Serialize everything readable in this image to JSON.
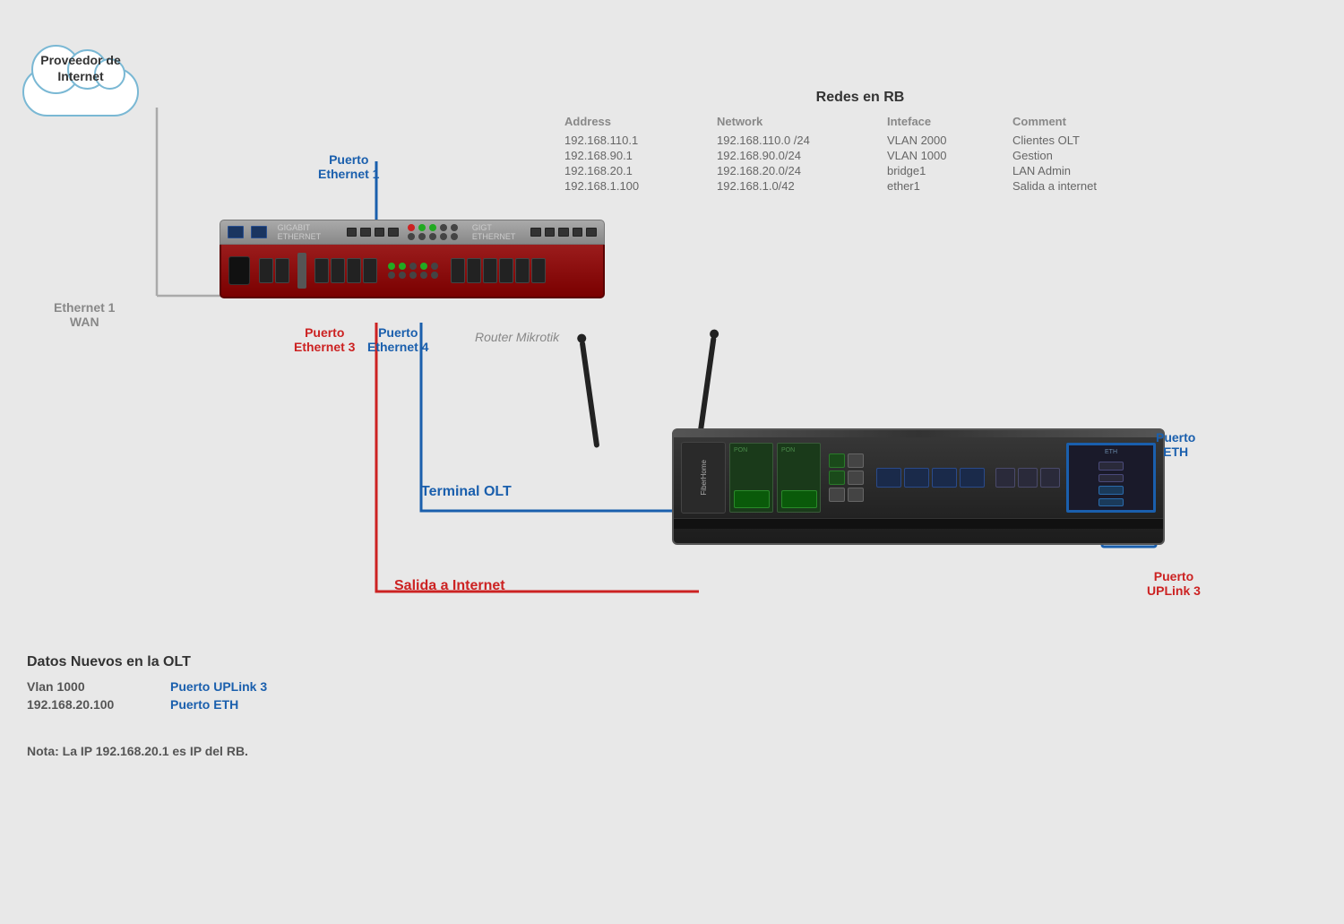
{
  "cloud": {
    "label_line1": "Proveedor de",
    "label_line2": "Internet"
  },
  "ethernet_wan": {
    "label_line1": "Ethernet 1",
    "label_line2": "WAN"
  },
  "router": {
    "label": "Router Mikrotik",
    "puerto_eth1_line1": "Puerto",
    "puerto_eth1_line2": "Ethernet 1",
    "puerto_eth3_line1": "Puerto",
    "puerto_eth3_line2": "Ethernet 3",
    "puerto_eth4_line1": "Puerto",
    "puerto_eth4_line2": "Ethernet 4"
  },
  "olt": {
    "title": "Terminal OLT",
    "puerto_eth_line1": "Puerto",
    "puerto_eth_line2": "ETH",
    "puerto_uplink_line1": "Puerto",
    "puerto_uplink_line2": "UPLink 3",
    "salida_internet": "Salida a Internet"
  },
  "redes_rb": {
    "title": "Redes en RB",
    "headers": [
      "Address",
      "Network",
      "Inteface",
      "Comment"
    ],
    "rows": [
      [
        "192.168.110.1",
        "192.168.110.0 /24",
        "VLAN 2000",
        "Clientes OLT"
      ],
      [
        "192.168.90.1",
        "192.168.90.0/24",
        "VLAN 1000",
        "Gestion"
      ],
      [
        "192.168.20.1",
        "192.168.20.0/24",
        "bridge1",
        "LAN Admin"
      ],
      [
        "192.168.1.100",
        "192.168.1.0/42",
        "ether1",
        "Salida a internet"
      ]
    ]
  },
  "datos_olt": {
    "title": "Datos Nuevos en  la OLT",
    "rows": [
      {
        "key": "Vlan 1000",
        "val": "Puerto UPLink 3"
      },
      {
        "key": "192.168.20.100",
        "val": "Puerto ETH"
      }
    ],
    "nota": "Nota: La IP 192.168.20.1 es IP del RB."
  }
}
